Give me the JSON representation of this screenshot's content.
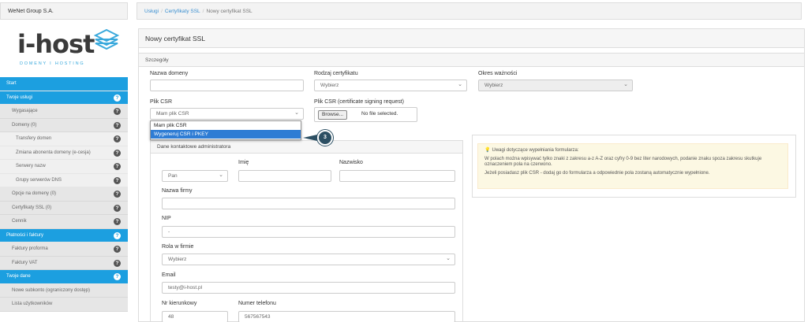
{
  "sidebar": {
    "company": "WeNet Group S.A.",
    "logo_main": "i-host",
    "logo_sub": "DOMENY I HOSTING",
    "items": [
      {
        "label": "Start",
        "style": "blue",
        "help": false
      },
      {
        "label": "Twoje usługi",
        "style": "blue",
        "help": true
      },
      {
        "label": "Wygasające",
        "style": "grey sub",
        "help": true
      },
      {
        "label": "Domeny (0)",
        "style": "grey sub",
        "help": true
      },
      {
        "label": "Transfery domen",
        "style": "grey2 subsub",
        "help": true
      },
      {
        "label": "Zmiana abonenta domeny (e-cesja)",
        "style": "grey2 subsub",
        "help": true
      },
      {
        "label": "Serwery nazw",
        "style": "grey2 subsub",
        "help": true
      },
      {
        "label": "Grupy serwerów DNS",
        "style": "grey2 subsub",
        "help": true
      },
      {
        "label": "Opcje na domeny (0)",
        "style": "grey sub",
        "help": true
      },
      {
        "label": "Certyfikaty SSL (0)",
        "style": "grey sub",
        "help": true
      },
      {
        "label": "Cennik",
        "style": "grey sub",
        "help": true
      },
      {
        "label": "Płatności i faktury",
        "style": "blue",
        "help": true
      },
      {
        "label": "Faktury proforma",
        "style": "grey sub",
        "help": true
      },
      {
        "label": "Faktury VAT",
        "style": "grey sub",
        "help": true
      },
      {
        "label": "Twoje dane",
        "style": "blue",
        "help": true
      },
      {
        "label": "Nowe subkonto (ograniczony dostęp)",
        "style": "grey sub",
        "help": false
      },
      {
        "label": "Lista użytkowników",
        "style": "grey sub",
        "help": false
      }
    ]
  },
  "breadcrumb": {
    "items": [
      "Usługi",
      "Certyfikaty SSL",
      "Nowy certyfikat SSL"
    ]
  },
  "panel": {
    "title": "Nowy certyfikat SSL",
    "section": "Szczegóły",
    "domain_label": "Nazwa domeny",
    "domain_value": "",
    "cert_type_label": "Rodzaj certyfikatu",
    "cert_type_value": "Wybierz",
    "validity_label": "Okres ważności",
    "validity_value": "Wybierz",
    "csr_label": "Plik CSR",
    "csr_value": "Mam plik CSR",
    "csr_file_label": "Plik CSR (certificate signing request)",
    "browse_label": "Browse...",
    "no_file": "No file selected.",
    "dropdown_options": [
      "Mam plik CSR",
      "Wygeneruj CSR i PKEY"
    ],
    "step_badge": "3"
  },
  "admin": {
    "title": "Dane kontaktowe administratora",
    "salutation_value": "Pan",
    "first_name_label": "Imię",
    "last_name_label": "Nazwisko",
    "company_label": "Nazwa firmy",
    "nip_label": "NIP",
    "nip_value": "-",
    "role_label": "Rola w firmie",
    "role_value": "Wybierz",
    "email_label": "Email",
    "email_value": "testy@i-host.pl",
    "area_code_label": "Nr kierunkowy",
    "area_code_value": "48",
    "phone_label": "Numer telefonu",
    "phone_value": "567567543"
  },
  "note": {
    "title": "Uwagi dotyczące wypełniania formularza:",
    "line1": "W polach można wpisywać tylko znaki z zakresu a-z A-Z oraz cyfry 0-9 bez liter narodowych, podanie znaku spoza zakresu skutkuje oznaczeniem pola na czerwono.",
    "line2": "Jeżeli posiadasz plik CSR - dodaj go do formularza a odpowiednie pola zostaną automatycznie wypełnione."
  },
  "colors": {
    "accent": "#1c9fe0",
    "badge": "#2c4f63",
    "highlight": "#2e7cd4"
  }
}
